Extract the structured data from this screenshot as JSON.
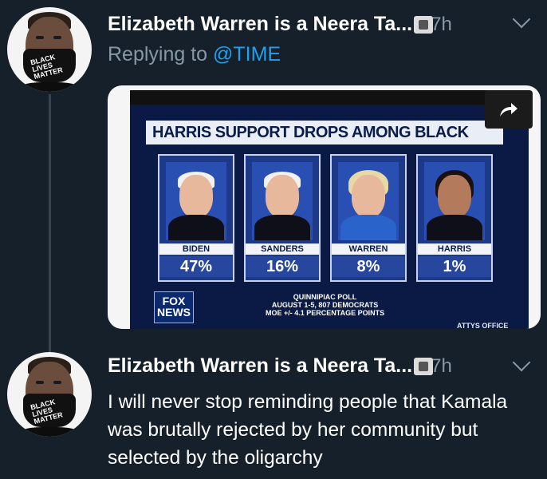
{
  "tweets": [
    {
      "author_name": "Elizabeth Warren is a Neera Ta...",
      "time": "7h",
      "reply_prefix": "Replying to ",
      "reply_handle": "@TIME",
      "avatar_mask_text": "BLACK LIVES MATTER"
    },
    {
      "author_name": "Elizabeth Warren is a Neera Ta...",
      "time": "7h",
      "text": "I will never stop reminding people that Kamala was brutally rejected by her community but selected by the oligarchy",
      "avatar_mask_text": "BLACK LIVES MATTER"
    }
  ],
  "media": {
    "headline": "HARRIS SUPPORT DROPS AMONG BLACK VOTERS",
    "candidates": [
      {
        "name": "BIDEN",
        "value": "47%"
      },
      {
        "name": "SANDERS",
        "value": "16%"
      },
      {
        "name": "WARREN",
        "value": "8%"
      },
      {
        "name": "HARRIS",
        "value": "1%"
      }
    ],
    "poll_line1": "QUINNIPIAC POLL",
    "poll_line2": "AUGUST 1-5, 807 DEMOCRATS",
    "poll_line3": "MOE +/- 4.1 PERCENTAGE POINTS",
    "logo_text": "FOX NEWS",
    "ticker_text": "ATTYS OFFICE"
  },
  "colors": {
    "background": "#15202b",
    "secondary_text": "#8899a6",
    "link": "#1da1f2"
  },
  "icons": [
    "share-icon",
    "chevron-down-icon",
    "verified-style-badge-icon"
  ]
}
